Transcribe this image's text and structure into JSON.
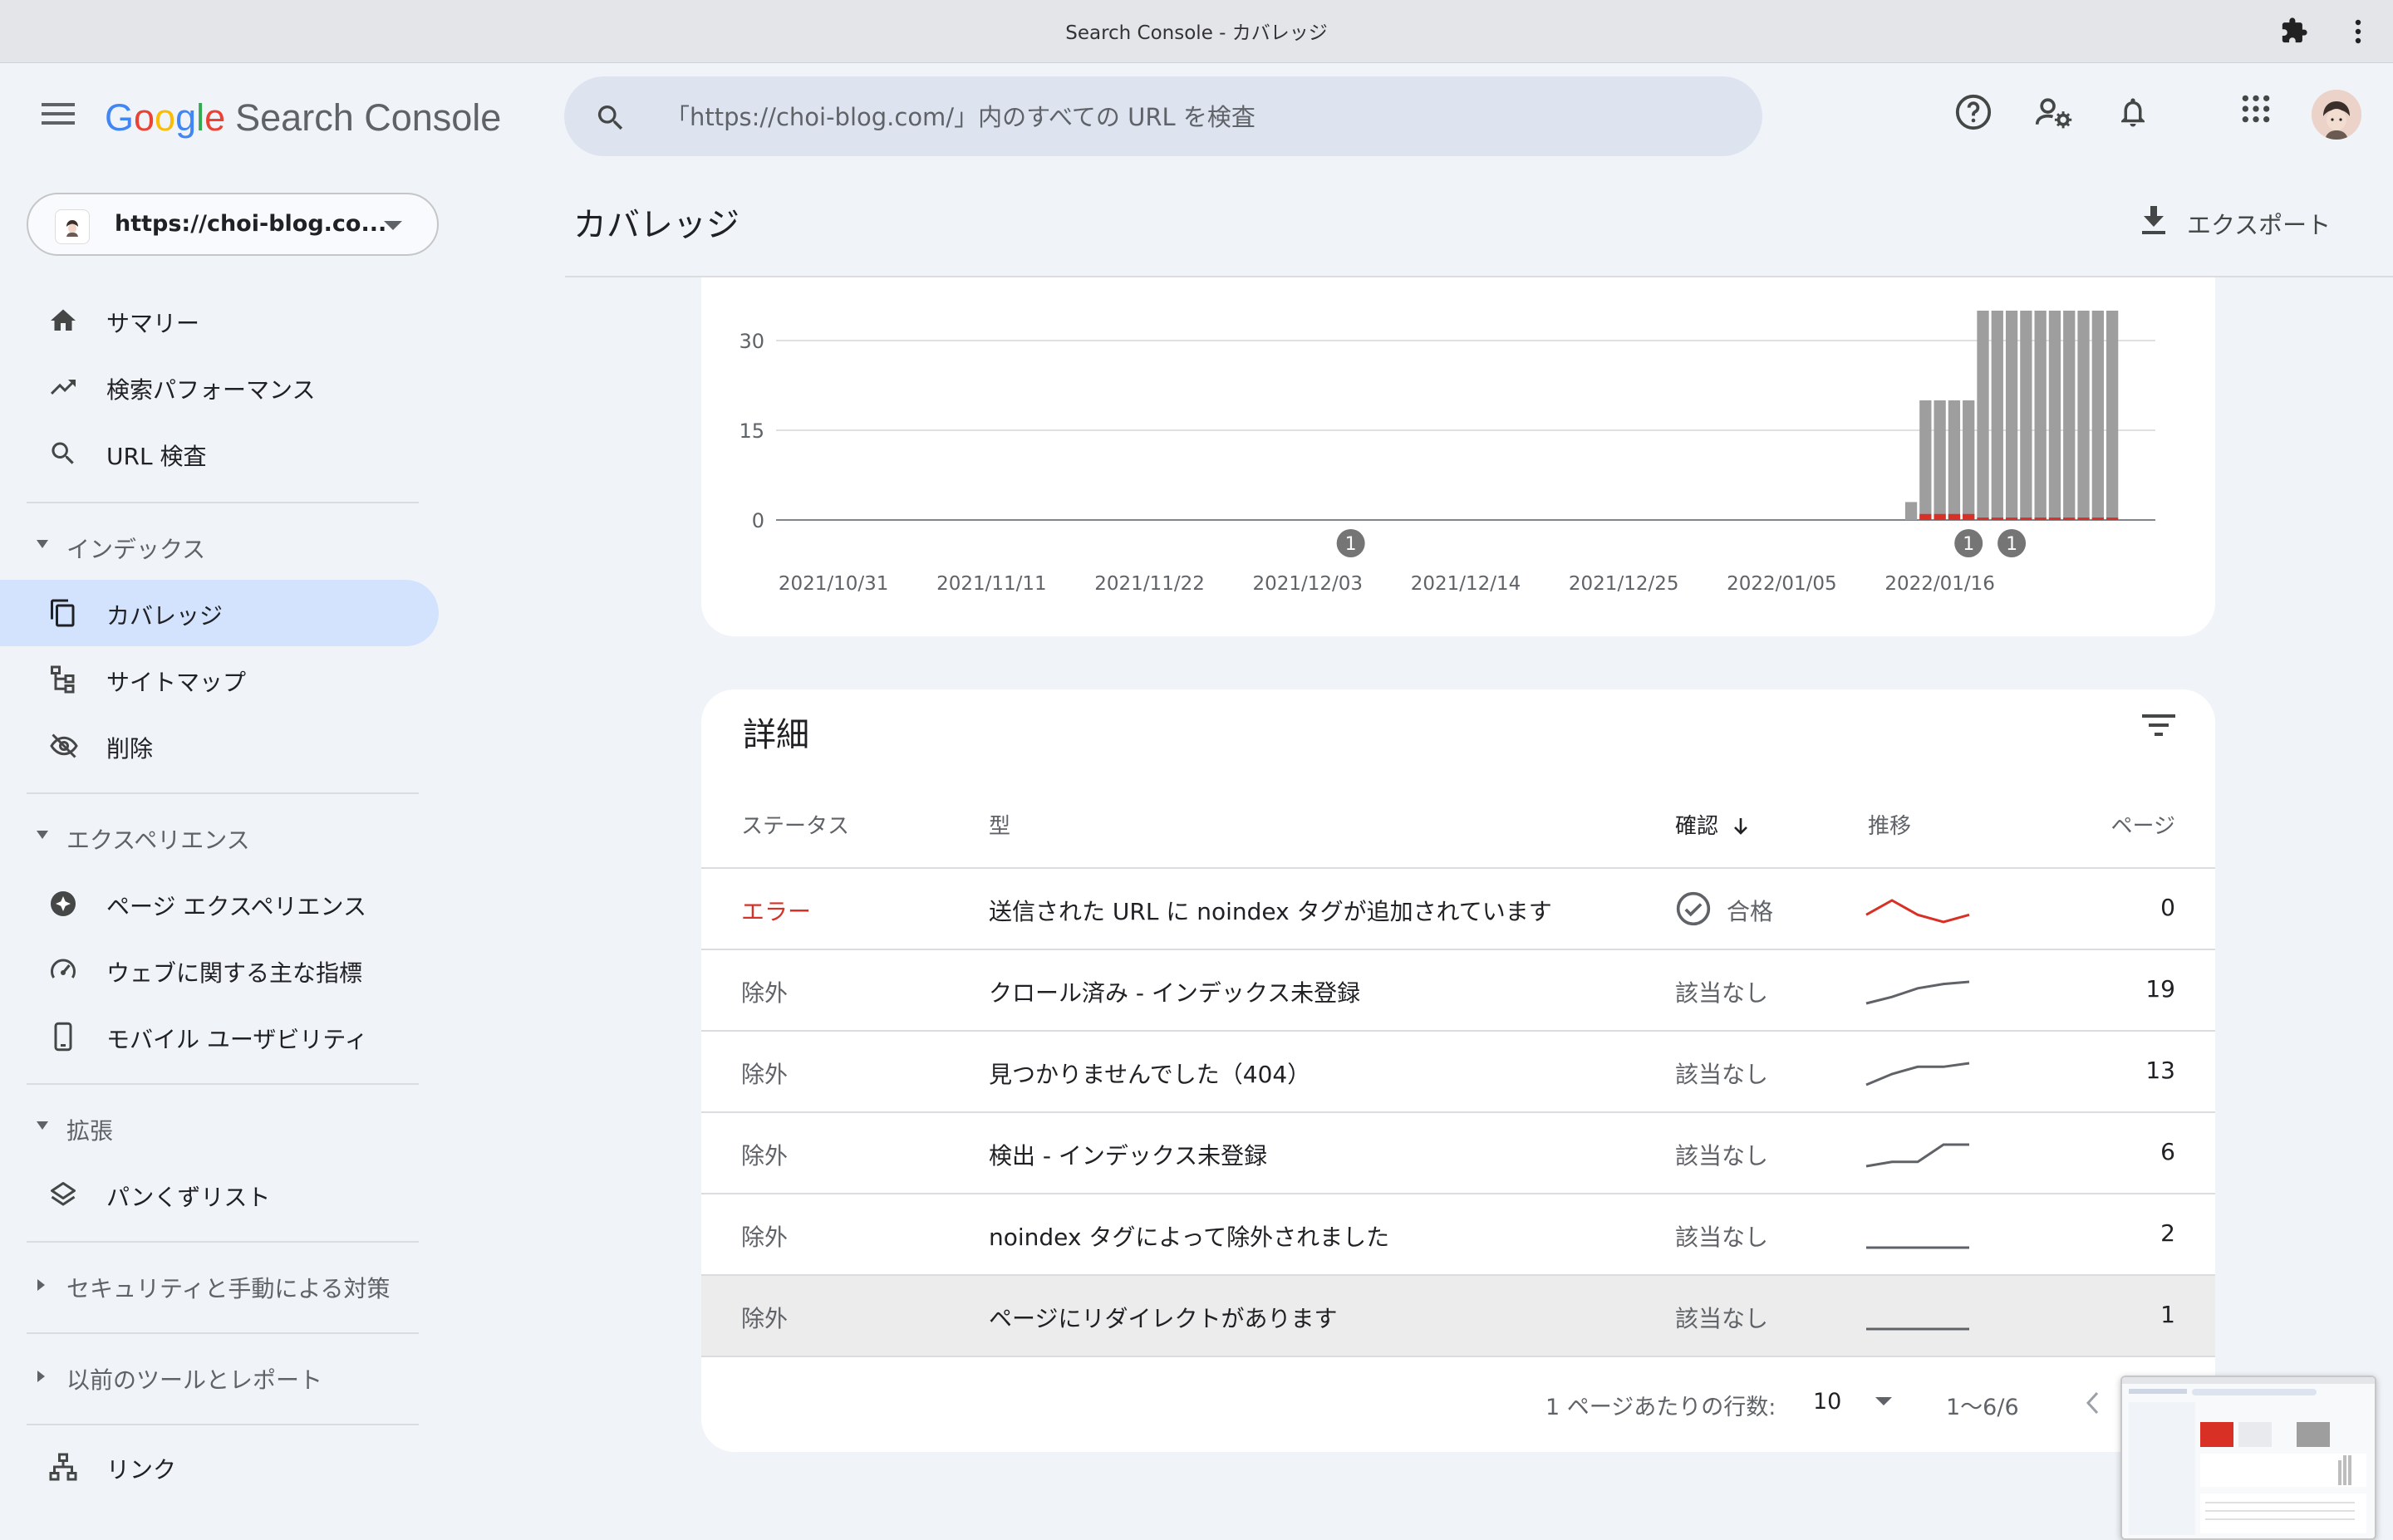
{
  "window": {
    "title": "Search Console - カバレッジ"
  },
  "header": {
    "logo_google": [
      "G",
      "o",
      "o",
      "g",
      "l",
      "e"
    ],
    "logo_product": "Search Console",
    "search_placeholder": "「https://choi-blog.com/」内のすべての URL を検査"
  },
  "property": {
    "label": "https://choi-blog.co..."
  },
  "sidebar": {
    "items_top": [
      {
        "label": "サマリー",
        "icon": "home-icon"
      },
      {
        "label": "検索パフォーマンス",
        "icon": "trending-up-icon"
      },
      {
        "label": "URL 検査",
        "icon": "search-icon"
      }
    ],
    "sections": [
      {
        "label": "インデックス",
        "expanded": true,
        "items": [
          {
            "label": "カバレッジ",
            "icon": "pages-icon",
            "active": true
          },
          {
            "label": "サイトマップ",
            "icon": "sitemap-icon"
          },
          {
            "label": "削除",
            "icon": "eye-off-icon"
          }
        ]
      },
      {
        "label": "エクスペリエンス",
        "expanded": true,
        "items": [
          {
            "label": "ページ エクスペリエンス",
            "icon": "plus-circle-icon"
          },
          {
            "label": "ウェブに関する主な指標",
            "icon": "speed-gauge-icon"
          },
          {
            "label": "モバイル ユーザビリティ",
            "icon": "phone-icon"
          }
        ]
      },
      {
        "label": "拡張",
        "expanded": true,
        "items": [
          {
            "label": "パンくずリスト",
            "icon": "layers-icon"
          }
        ]
      },
      {
        "label": "セキュリティと手動による対策",
        "expanded": false
      },
      {
        "label": "以前のツールとレポート",
        "expanded": false
      }
    ],
    "items_bottom": [
      {
        "label": "リンク",
        "icon": "links-icon"
      }
    ]
  },
  "main": {
    "title": "カバレッジ",
    "export_label": "エクスポート"
  },
  "chart_data": {
    "type": "bar",
    "y_ticks": [
      "30",
      "15",
      "0"
    ],
    "ylim": [
      0,
      35
    ],
    "x_tick_labels": [
      "2021/10/31",
      "2021/11/11",
      "2021/11/22",
      "2021/12/03",
      "2021/12/14",
      "2021/12/25",
      "2022/01/05",
      "2022/01/16"
    ],
    "series": [
      {
        "name": "",
        "color": "#9e9e9e",
        "dates": [
          "2022/01/14",
          "2022/01/15",
          "2022/01/16",
          "2022/01/17",
          "2022/01/18",
          "2022/01/19",
          "2022/01/20",
          "2022/01/21",
          "2022/01/22",
          "2022/01/23",
          "2022/01/24",
          "2022/01/25",
          "2022/01/26",
          "2022/01/27",
          "2022/01/28"
        ],
        "values": [
          3,
          20,
          20,
          20,
          20,
          35,
          35,
          35,
          35,
          35,
          35,
          35,
          35,
          35,
          35
        ]
      },
      {
        "name": "",
        "color": "#d93025",
        "dates": [
          "2022/01/15",
          "2022/01/16",
          "2022/01/17",
          "2022/01/18",
          "2022/01/19",
          "2022/01/20",
          "2022/01/21",
          "2022/01/22",
          "2022/01/23",
          "2022/01/24",
          "2022/01/25",
          "2022/01/26",
          "2022/01/27",
          "2022/01/28"
        ],
        "values": [
          1,
          1,
          1,
          1,
          0.4,
          0.4,
          0.4,
          0.4,
          0.4,
          0.4,
          0.4,
          0.4,
          0.4,
          0.4
        ]
      }
    ],
    "annotations": [
      {
        "label": "1",
        "date": "2021/12/06"
      },
      {
        "label": "1",
        "date": "2022/01/18"
      },
      {
        "label": "1",
        "date": "2022/01/21"
      }
    ],
    "grid": true
  },
  "details": {
    "title": "詳細",
    "columns": {
      "status": "ステータス",
      "type": "型",
      "validation": "確認",
      "trend": "推移",
      "pages": "ページ"
    },
    "rows": [
      {
        "status": "エラー",
        "type": "送信された URL に noindex タグが追加されています",
        "validation": "合格",
        "pages": "0",
        "trend": [
          1,
          1.2,
          1,
          0.9,
          1
        ],
        "trend_color": "#d93025"
      },
      {
        "status": "除外",
        "type": "クロール済み - インデックス未登録",
        "validation": "該当なし",
        "pages": "19",
        "trend": [
          9,
          12,
          16,
          18,
          19
        ],
        "trend_color": "#5f6368"
      },
      {
        "status": "除外",
        "type": "見つかりませんでした（404）",
        "validation": "該当なし",
        "pages": "13",
        "trend": [
          7,
          10,
          12,
          12,
          13
        ],
        "trend_color": "#5f6368"
      },
      {
        "status": "除外",
        "type": "検出 - インデックス未登録",
        "validation": "該当なし",
        "pages": "6",
        "trend": [
          5,
          5.2,
          5.2,
          6,
          6
        ],
        "trend_color": "#5f6368"
      },
      {
        "status": "除外",
        "type": "noindex タグによって除外されました",
        "validation": "該当なし",
        "pages": "2",
        "trend": [
          2,
          2,
          2,
          2,
          2
        ],
        "trend_color": "#5f6368"
      },
      {
        "status": "除外",
        "type": "ページにリダイレクトがあります",
        "validation": "該当なし",
        "pages": "1",
        "trend": [
          1,
          1,
          1,
          1,
          1
        ],
        "trend_color": "#5f6368"
      }
    ],
    "footer": {
      "rows_per_page_label": "1 ページあたりの行数:",
      "rows_per_page_value": "10",
      "range": "1〜6/6"
    }
  }
}
